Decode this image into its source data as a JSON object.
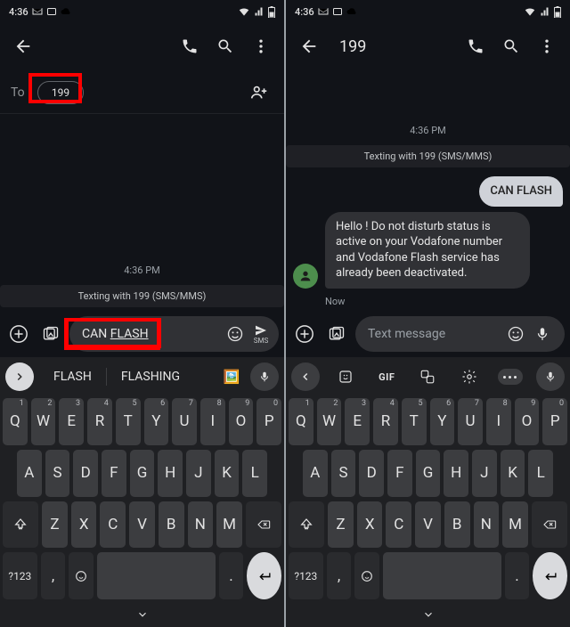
{
  "status": {
    "time": "4:36",
    "wifi": true,
    "signal": true,
    "battery": true
  },
  "left": {
    "to_label": "To",
    "recipient_chip": "199",
    "appbar_actions": [
      "phone",
      "search",
      "more"
    ],
    "timestamp": "4:36 PM",
    "banner": "Texting with 199 (SMS/MMS)",
    "composer": {
      "text_pre": "CAN ",
      "text_ul": "FLASH",
      "send_label": "SMS"
    },
    "keyboard": {
      "suggestions": [
        "FLASH",
        "FLASHING"
      ],
      "row1": [
        [
          "Q",
          "1"
        ],
        [
          "W",
          "2"
        ],
        [
          "E",
          "3"
        ],
        [
          "R",
          "4"
        ],
        [
          "T",
          "5"
        ],
        [
          "Y",
          "6"
        ],
        [
          "U",
          "7"
        ],
        [
          "I",
          "8"
        ],
        [
          "O",
          "9"
        ],
        [
          "P",
          "0"
        ]
      ],
      "row2": [
        "A",
        "S",
        "D",
        "F",
        "G",
        "H",
        "J",
        "K",
        "L"
      ],
      "row3": [
        "Z",
        "X",
        "C",
        "V",
        "B",
        "N",
        "M"
      ],
      "sym": "?123",
      "comma": ",",
      "period": "."
    }
  },
  "right": {
    "title": "199",
    "appbar_actions": [
      "phone",
      "search",
      "more"
    ],
    "timestamp": "4:36 PM",
    "banner": "Texting with 199 (SMS/MMS)",
    "msg_out": "CAN FLASH",
    "msg_in": "Hello ! Do not disturb status is  active on your Vodafone number and Vodafone Flash service has already been deactivated.",
    "msg_in_ts": "Now",
    "composer": {
      "placeholder": "Text message"
    },
    "keyboard": {
      "row1": [
        [
          "Q",
          "1"
        ],
        [
          "W",
          "2"
        ],
        [
          "E",
          "3"
        ],
        [
          "R",
          "4"
        ],
        [
          "T",
          "5"
        ],
        [
          "Y",
          "6"
        ],
        [
          "U",
          "7"
        ],
        [
          "I",
          "8"
        ],
        [
          "O",
          "9"
        ],
        [
          "P",
          "0"
        ]
      ],
      "row2": [
        "A",
        "S",
        "D",
        "F",
        "G",
        "H",
        "J",
        "K",
        "L"
      ],
      "row3": [
        "Z",
        "X",
        "C",
        "V",
        "B",
        "N",
        "M"
      ],
      "sym": "?123",
      "comma": ",",
      "period": "."
    }
  }
}
